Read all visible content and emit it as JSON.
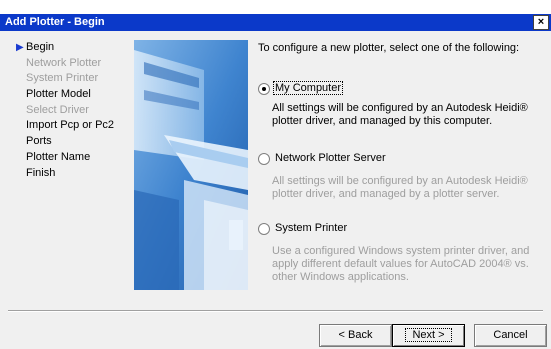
{
  "window": {
    "title": "Add Plotter - Begin",
    "close_label": "×"
  },
  "steps": [
    {
      "label": "Begin",
      "state": "current"
    },
    {
      "label": "Network Plotter",
      "state": "disabled"
    },
    {
      "label": "System Printer",
      "state": "disabled"
    },
    {
      "label": "Plotter Model",
      "state": "enabled"
    },
    {
      "label": "Select Driver",
      "state": "disabled"
    },
    {
      "label": "Import Pcp or Pc2",
      "state": "enabled"
    },
    {
      "label": "Ports",
      "state": "enabled"
    },
    {
      "label": "Plotter Name",
      "state": "enabled"
    },
    {
      "label": "Finish",
      "state": "enabled"
    }
  ],
  "main": {
    "intro": "To configure a new plotter, select one of the following:",
    "options": [
      {
        "label": "My Computer",
        "selected": true,
        "description": "All settings will be configured by an Autodesk Heidi® plotter driver, and managed by this computer."
      },
      {
        "label": "Network Plotter Server",
        "selected": false,
        "description": "All settings will be configured by an Autodesk Heidi® plotter driver, and managed by a plotter server."
      },
      {
        "label": "System Printer",
        "selected": false,
        "description": "Use a configured Windows system printer driver, and apply different default values for AutoCAD 2004® vs. other Windows applications."
      }
    ]
  },
  "buttons": {
    "back": "< Back",
    "next": "Next >",
    "cancel": "Cancel"
  },
  "colors": {
    "title_bar": "#0b39c9",
    "current_step_arrow": "#1a3bd0",
    "disabled_text": "#9e9e9e"
  }
}
